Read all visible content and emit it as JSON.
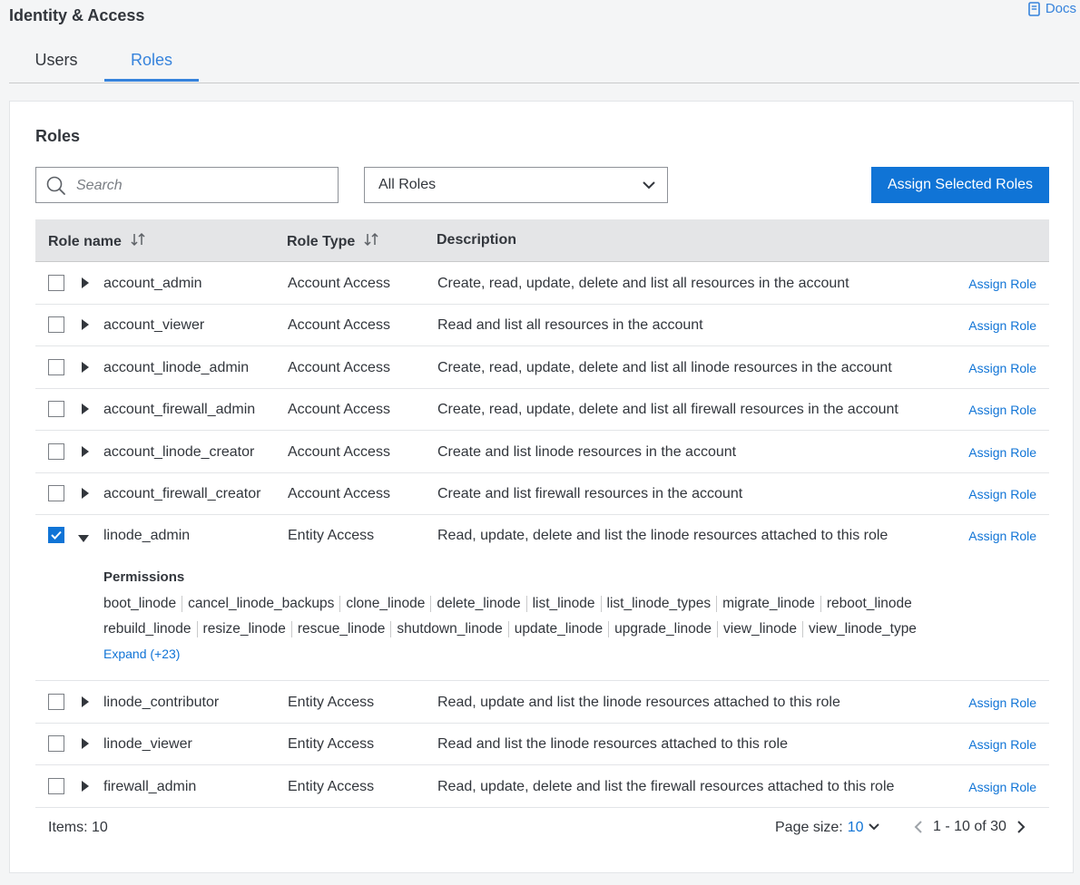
{
  "header": {
    "title": "Identity & Access",
    "docs_label": "Docs"
  },
  "tabs": [
    {
      "label": "Users",
      "active": false
    },
    {
      "label": "Roles",
      "active": true
    }
  ],
  "card": {
    "title": "Roles",
    "search": {
      "placeholder": "Search",
      "value": ""
    },
    "filter": {
      "selected": "All Roles"
    },
    "assign_selected_label": "Assign Selected Roles"
  },
  "table": {
    "columns": {
      "name": "Role name",
      "type": "Role Type",
      "description": "Description"
    },
    "assign_label": "Assign Role",
    "rows": [
      {
        "name": "account_admin",
        "type": "Account Access",
        "description": "Create, read, update, delete and list all resources in the account",
        "checked": false,
        "expanded": false
      },
      {
        "name": "account_viewer",
        "type": "Account Access",
        "description": "Read and list all resources in the account",
        "checked": false,
        "expanded": false
      },
      {
        "name": "account_linode_admin",
        "type": "Account Access",
        "description": "Create, read, update, delete and list all linode resources in the account",
        "checked": false,
        "expanded": false
      },
      {
        "name": "account_firewall_admin",
        "type": "Account Access",
        "description": "Create, read, update, delete and list all firewall resources in the account",
        "checked": false,
        "expanded": false
      },
      {
        "name": "account_linode_creator",
        "type": "Account Access",
        "description": "Create and list linode resources in the account",
        "checked": false,
        "expanded": false
      },
      {
        "name": "account_firewall_creator",
        "type": "Account Access",
        "description": "Create and list firewall resources in the account",
        "checked": false,
        "expanded": false
      },
      {
        "name": "linode_admin",
        "type": "Entity Access",
        "description": "Read, update, delete and list the linode resources attached to this role",
        "checked": true,
        "expanded": true
      },
      {
        "name": "linode_contributor",
        "type": "Entity Access",
        "description": "Read, update and list the linode resources attached to this role",
        "checked": false,
        "expanded": false
      },
      {
        "name": "linode_viewer",
        "type": "Entity Access",
        "description": "Read and list the linode resources attached to this role",
        "checked": false,
        "expanded": false
      },
      {
        "name": "firewall_admin",
        "type": "Entity Access",
        "description": "Read, update, delete and list the firewall resources attached to this role",
        "checked": false,
        "expanded": false
      }
    ],
    "permissions": {
      "title": "Permissions",
      "line1": [
        "boot_linode",
        "cancel_linode_backups",
        "clone_linode",
        "delete_linode",
        "list_linode",
        "list_linode_types",
        "migrate_linode",
        "reboot_linode"
      ],
      "line2": [
        "rebuild_linode",
        "resize_linode",
        "rescue_linode",
        "shutdown_linode",
        "update_linode",
        "upgrade_linode",
        "view_linode",
        "view_linode_type"
      ],
      "expand_label": "Expand (+23)"
    }
  },
  "footer": {
    "items_label": "Items: 10",
    "page_size_label": "Page size:",
    "page_size_value": "10",
    "range_label": "1 - 10 of 30"
  },
  "colors": {
    "accent": "#1074d6",
    "link": "#3683dc",
    "header_bg": "#e4e5e7"
  }
}
